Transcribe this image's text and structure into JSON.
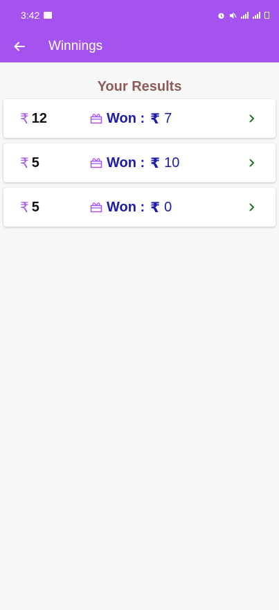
{
  "status_bar": {
    "time": "3:42"
  },
  "appbar": {
    "title": "Winnings"
  },
  "section_title": "Your Results",
  "currency_symbol": "₹",
  "won_label": "Won :",
  "results": [
    {
      "entry": "12",
      "won": "7"
    },
    {
      "entry": "5",
      "won": "10"
    },
    {
      "entry": "5",
      "won": "0"
    }
  ],
  "colors": {
    "header": "#a553f0",
    "section_title": "#8e5a5a",
    "won_text": "#1b1ba8",
    "chevron": "#1a7a1a"
  }
}
